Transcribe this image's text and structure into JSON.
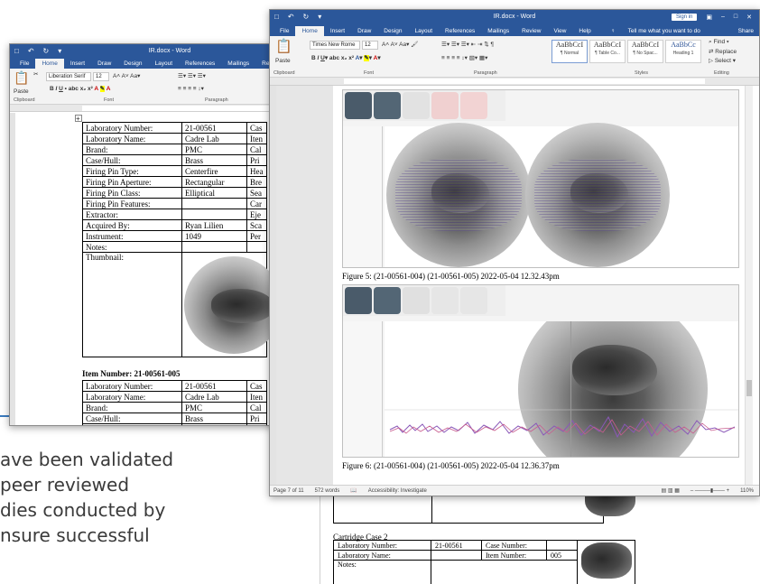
{
  "slide": {
    "lines": [
      "ave been validated",
      "peer reviewed",
      "dies conducted by",
      "nsure successful"
    ]
  },
  "left_window": {
    "title": "IR.docx - Word",
    "tabs": [
      "File",
      "Home",
      "Insert",
      "Draw",
      "Design",
      "Layout",
      "References",
      "Mailings",
      "Review"
    ],
    "active_tab": "Home",
    "font_name": "Liberation Serif",
    "font_size": "12",
    "groups": [
      "Clipboard",
      "Font",
      "Paragraph"
    ],
    "paste_label": "Paste",
    "table1": [
      [
        "Laboratory Number:",
        "21-00561",
        "Cas"
      ],
      [
        "Laboratory Name:",
        "Cadre Lab",
        "Iten"
      ],
      [
        "Brand:",
        "PMC",
        "Cal"
      ],
      [
        "Case/Hull:",
        "Brass",
        "Pri"
      ],
      [
        "Firing Pin Type:",
        "Centerfire",
        "Hea"
      ],
      [
        "Firing Pin Aperture:",
        "Rectangular",
        "Bre"
      ],
      [
        "Firing Pin Class:",
        "Elliptical",
        "Sea"
      ],
      [
        "Firing Pin Features:",
        "",
        "Car"
      ],
      [
        "Extractor:",
        "",
        "Eje"
      ],
      [
        "Acquired By:",
        "Ryan Lilien",
        "Sca"
      ],
      [
        "Instrument:",
        "1049",
        "Per"
      ],
      [
        "Notes:",
        "",
        ""
      ],
      [
        "Thumbnail:",
        "",
        ""
      ]
    ],
    "item_heading": "Item Number: 21-00561-005",
    "table2": [
      [
        "Laboratory Number:",
        "21-00561",
        "Cas"
      ],
      [
        "Laboratory Name:",
        "Cadre Lab",
        "Iten"
      ],
      [
        "Brand:",
        "PMC",
        "Cal"
      ],
      [
        "Case/Hull:",
        "Brass",
        "Pri"
      ],
      [
        "Firing Pin Type:",
        "Centerfire",
        "Hea"
      ]
    ]
  },
  "right_window": {
    "title": "IR.docx - Word",
    "sign_in": "Sign in",
    "tabs": [
      "File",
      "Home",
      "Insert",
      "Draw",
      "Design",
      "Layout",
      "References",
      "Mailings",
      "Review",
      "View",
      "Help"
    ],
    "active_tab": "Home",
    "tell_me": "Tell me what you want to do",
    "share": "Share",
    "font_name": "Times New Rome",
    "font_size": "12",
    "groups": [
      "Clipboard",
      "Font",
      "Paragraph",
      "Styles",
      "Editing"
    ],
    "paste_label": "Paste",
    "styles": [
      {
        "sample": "AaBbCcI",
        "name": "¶ Normal"
      },
      {
        "sample": "AaBbCcI",
        "name": "¶ Table Co..."
      },
      {
        "sample": "AaBbCcI",
        "name": "¶ No Spac..."
      },
      {
        "sample": "AaBbCc",
        "name": "Heading 1"
      }
    ],
    "editing": [
      "Find",
      "Replace",
      "Select"
    ],
    "figure5_caption": "Figure 5:  (21-00561-004) (21-00561-005) 2022-05-04 12.32.43pm",
    "figure6_caption": "Figure 6:  (21-00561-004) (21-00561-005) 2022-05-04 12.36.37pm",
    "status": {
      "page": "Page 7 of 11",
      "words": "572 words",
      "accessibility": "Accessibility: Investigate",
      "zoom": "110%"
    }
  },
  "back_doc": {
    "heading": "Cartridge Case 2",
    "rows": [
      [
        "Laboratory Number:",
        "21-00561",
        "Case Number:",
        ""
      ],
      [
        "Laboratory Name:",
        "",
        "Item Number:",
        "005"
      ],
      [
        "Notes:",
        "",
        "",
        ""
      ]
    ]
  }
}
